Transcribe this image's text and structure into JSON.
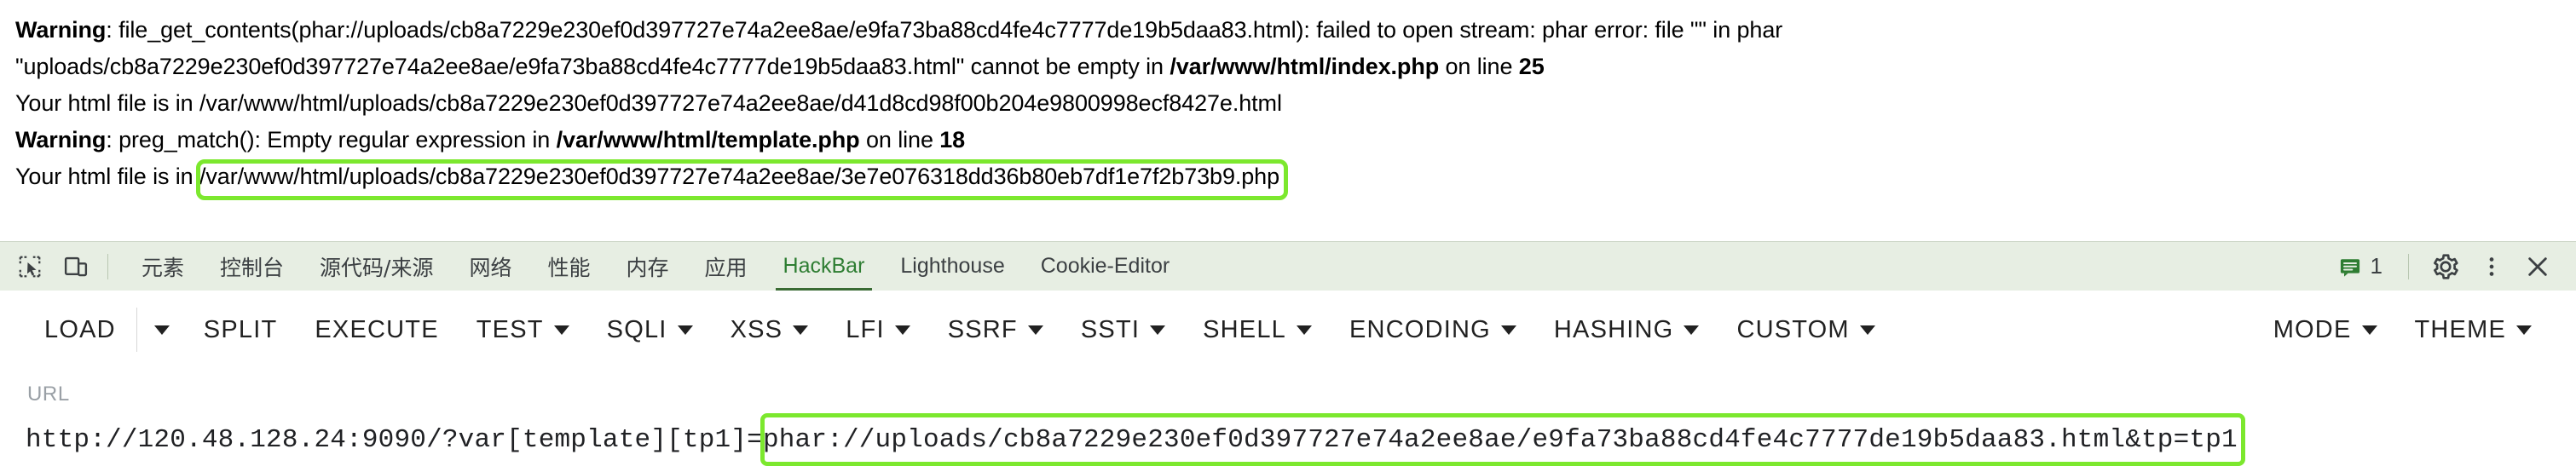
{
  "php_output": {
    "lines": [
      {
        "segments": [
          {
            "text": "Warning",
            "bold": true
          },
          {
            "text": ": file_get_contents(phar://uploads/cb8a7229e230ef0d397727e74a2ee8ae/e9fa73ba88cd4fe4c7777de19b5daa83.html): failed to open stream: phar error: file \"\" in phar",
            "bold": false
          }
        ]
      },
      {
        "segments": [
          {
            "text": "\"uploads/cb8a7229e230ef0d397727e74a2ee8ae/e9fa73ba88cd4fe4c7777de19b5daa83.html\" cannot be empty in ",
            "bold": false
          },
          {
            "text": "/var/www/html/index.php",
            "bold": true
          },
          {
            "text": " on line ",
            "bold": false
          },
          {
            "text": "25",
            "bold": true
          }
        ]
      },
      {
        "segments": [
          {
            "text": "Your html file is in /var/www/html/uploads/cb8a7229e230ef0d397727e74a2ee8ae/d41d8cd98f00b204e9800998ecf8427e.html",
            "bold": false
          }
        ]
      },
      {
        "segments": [
          {
            "text": "Warning",
            "bold": true
          },
          {
            "text": ": preg_match(): Empty regular expression in ",
            "bold": false
          },
          {
            "text": "/var/www/html/template.php",
            "bold": true
          },
          {
            "text": " on line ",
            "bold": false
          },
          {
            "text": "18",
            "bold": true
          }
        ]
      },
      {
        "segments": [
          {
            "text": "Your html file is in /var/www/html/uploads/cb8a7229e230ef0d397727e74a2ee8ae/3e7e076318dd36b80eb7df1e7f2b73b9.php",
            "bold": false
          }
        ]
      }
    ],
    "annotation_color": "#7CE82E"
  },
  "devtools": {
    "left_icons": [
      {
        "name": "inspect-element-icon"
      },
      {
        "name": "device-toolbar-icon"
      }
    ],
    "tabs": [
      {
        "label": "元素",
        "cjk": true,
        "active": false
      },
      {
        "label": "控制台",
        "cjk": true,
        "active": false
      },
      {
        "label": "源代码/来源",
        "cjk": true,
        "active": false
      },
      {
        "label": "网络",
        "cjk": true,
        "active": false
      },
      {
        "label": "性能",
        "cjk": true,
        "active": false
      },
      {
        "label": "内存",
        "cjk": true,
        "active": false
      },
      {
        "label": "应用",
        "cjk": true,
        "active": false
      },
      {
        "label": "HackBar",
        "cjk": false,
        "active": true
      },
      {
        "label": "Lighthouse",
        "cjk": false,
        "active": false
      },
      {
        "label": "Cookie-Editor",
        "cjk": false,
        "active": false
      }
    ],
    "active_tab_color": "#2E7D32",
    "message_count": "1",
    "right_icons": [
      {
        "name": "settings-gear-icon"
      },
      {
        "name": "more-options-icon"
      },
      {
        "name": "close-devtools-icon"
      }
    ]
  },
  "hackbar": {
    "buttons": [
      {
        "label": "LOAD",
        "caret": false,
        "split_caret": true
      },
      {
        "label": "SPLIT",
        "caret": false,
        "split_caret": false
      },
      {
        "label": "EXECUTE",
        "caret": false,
        "split_caret": false
      },
      {
        "label": "TEST",
        "caret": true,
        "split_caret": false
      },
      {
        "label": "SQLI",
        "caret": true,
        "split_caret": false
      },
      {
        "label": "XSS",
        "caret": true,
        "split_caret": false
      },
      {
        "label": "LFI",
        "caret": true,
        "split_caret": false
      },
      {
        "label": "SSRF",
        "caret": true,
        "split_caret": false
      },
      {
        "label": "SSTI",
        "caret": true,
        "split_caret": false
      },
      {
        "label": "SHELL",
        "caret": true,
        "split_caret": false
      },
      {
        "label": "ENCODING",
        "caret": true,
        "split_caret": false
      },
      {
        "label": "HASHING",
        "caret": true,
        "split_caret": false
      },
      {
        "label": "CUSTOM",
        "caret": true,
        "split_caret": false
      }
    ],
    "right_buttons": [
      {
        "label": "MODE",
        "caret": true
      },
      {
        "label": "THEME",
        "caret": true
      }
    ]
  },
  "url_section": {
    "label": "URL",
    "prefix": "http://120.48.128.24:9090/?var[template][tp1]=",
    "highlighted": "phar://uploads/cb8a7229e230ef0d397727e74a2ee8ae/e9fa73ba88cd4fe4c7777de19b5daa83.html&tp=tp1",
    "full_value": "http://120.48.128.24:9090/?var[template][tp1]=phar://uploads/cb8a7229e230ef0d397727e74a2ee8ae/e9fa73ba88cd4fe4c7777de19b5daa83.html&tp=tp1",
    "annotation_color": "#7CE82E"
  }
}
